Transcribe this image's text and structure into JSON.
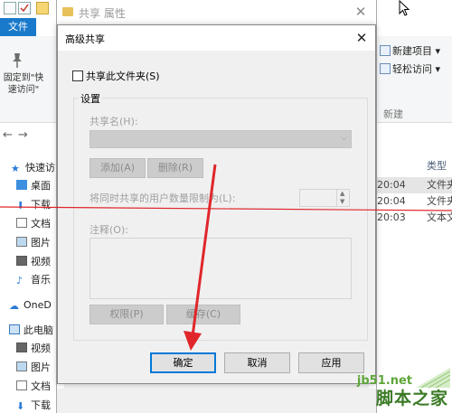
{
  "explorer": {
    "file_tab": "文件",
    "pin_label": "固定到\"快速访问\"",
    "ribbon_items": [
      "新建项目 ▾",
      "轻松访问 ▾"
    ],
    "ribbon_group": "新建",
    "nav_items": [
      {
        "label": "快速访",
        "icon": "star-icon"
      },
      {
        "label": "桌面",
        "icon": "desktop-icon"
      },
      {
        "label": "下载",
        "icon": "download-icon"
      },
      {
        "label": "文档",
        "icon": "document-icon"
      },
      {
        "label": "图片",
        "icon": "picture-icon"
      },
      {
        "label": "视频",
        "icon": "video-icon"
      },
      {
        "label": "音乐",
        "icon": "music-icon"
      },
      {
        "label": "OneD",
        "icon": "cloud-icon"
      },
      {
        "label": "此电脑",
        "icon": "computer-icon"
      },
      {
        "label": "视频",
        "icon": "video-icon"
      },
      {
        "label": "图片",
        "icon": "picture-icon"
      },
      {
        "label": "文档",
        "icon": "document-icon"
      },
      {
        "label": "下载",
        "icon": "download-icon"
      }
    ],
    "column_type": "类型",
    "rows": [
      {
        "time": "20:04",
        "type": "文件夹"
      },
      {
        "time": "20:04",
        "type": "文件夹"
      },
      {
        "time": "20:03",
        "type": "文本文"
      }
    ]
  },
  "properties_window": {
    "title": "共享 属性",
    "close": "✕"
  },
  "dialog": {
    "title": "高级共享",
    "close": "✕",
    "share_checkbox_label": "共享此文件夹(S)",
    "share_checked": false,
    "settings_group": "设置",
    "share_name_label": "共享名(H):",
    "add_button": "添加(A)",
    "remove_button": "删除(R)",
    "user_limit_label": "将同时共享的用户数量限制为(L):",
    "comment_label": "注释(O):",
    "permissions_button": "权限(P)",
    "cache_button": "缓存(C)",
    "ok_button": "确定",
    "cancel_button": "取消",
    "apply_button": "应用"
  },
  "watermark": {
    "site": "jb51.net",
    "name": "脚本之家"
  },
  "colors": {
    "accent": "#0078d7",
    "annotation_red": "#e0262b",
    "file_tab": "#1979ca"
  }
}
